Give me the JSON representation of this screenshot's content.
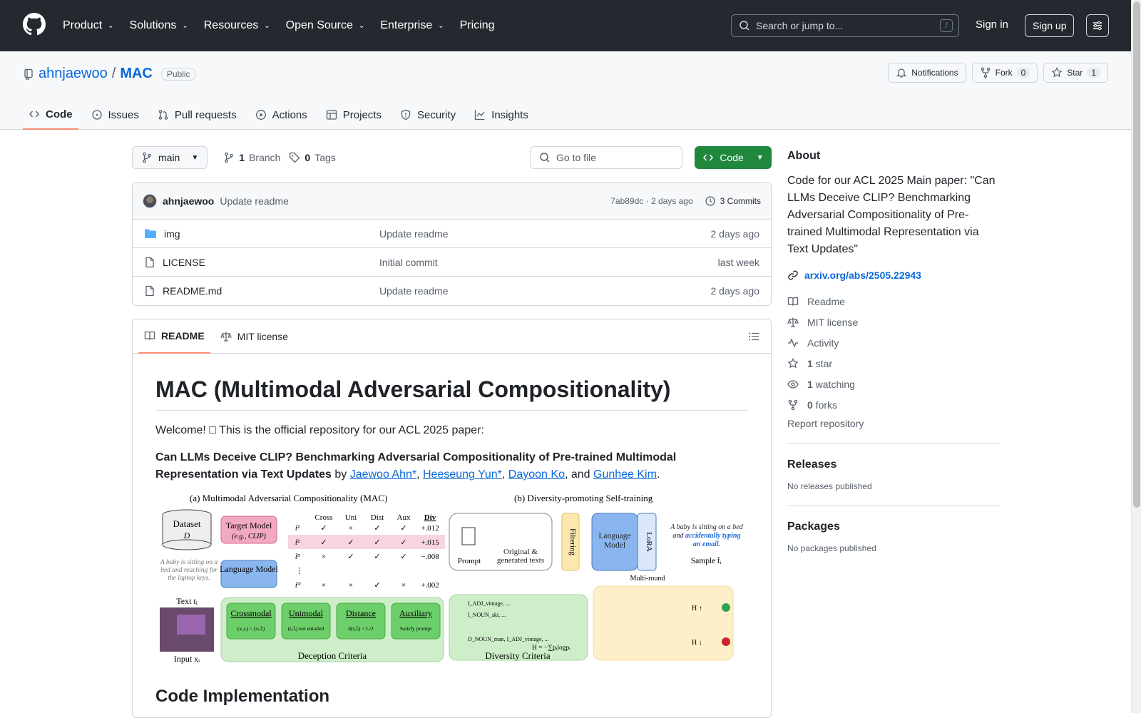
{
  "header": {
    "nav": [
      "Product",
      "Solutions",
      "Resources",
      "Open Source",
      "Enterprise",
      "Pricing"
    ],
    "search_placeholder": "Search or jump to...",
    "search_shortcut": "/",
    "signin": "Sign in",
    "signup": "Sign up"
  },
  "repo": {
    "owner": "ahnjaewoo",
    "separator": "/",
    "name": "MAC",
    "visibility": "Public",
    "notifications": "Notifications",
    "fork_label": "Fork",
    "fork_count": "0",
    "star_label": "Star",
    "star_count": "1"
  },
  "tabs": [
    "Code",
    "Issues",
    "Pull requests",
    "Actions",
    "Projects",
    "Security",
    "Insights"
  ],
  "filebar": {
    "branch": "main",
    "branch_count": "1",
    "branch_label": "Branch",
    "tag_count": "0",
    "tag_label": "Tags",
    "goto_placeholder": "Go to file",
    "code_button": "Code"
  },
  "commit": {
    "author": "ahnjaewoo",
    "message": "Update readme",
    "hash_time": "7ab89dc · 2 days ago",
    "commits": "3 Commits"
  },
  "files": [
    {
      "name": "img",
      "message": "Update readme",
      "date": "2 days ago"
    },
    {
      "name": "LICENSE",
      "message": "Initial commit",
      "date": "last week"
    },
    {
      "name": "README.md",
      "message": "Update readme",
      "date": "2 days ago"
    }
  ],
  "readme": {
    "tab_readme": "README",
    "tab_license": "MIT license",
    "title": "MAC (Multimodal Adversarial Compositionality)",
    "welcome": "Welcome! □ This is the official repository for our ACL 2025 paper:",
    "paper_title": "Can LLMs Deceive CLIP? Benchmarking Adversarial Compositionality of Pre-trained Multimodal Representation via Text Updates",
    "by": " by ",
    "authors": [
      "Jaewoo Ahn*",
      "Heeseung Yun*",
      "Dayoon Ko",
      "Gunhee Kim"
    ],
    "sep1": ", ",
    "sep_and": ", and ",
    "period": ".",
    "next_heading": "Code Implementation",
    "figure": {
      "title_a": "(a) Multimodal Adversarial Compositionality (MAC)",
      "title_b": "(b) Diversity-promoting Self-training",
      "dataset": "Dataset",
      "dataset_sym": "D",
      "target_model": "Target Model",
      "target_sub": "(e.g., CLIP)",
      "language_model": "Language Model",
      "caption": "A baby is sitting on a bed and reaching for the laptop keys.",
      "text_label": "Text tᵢ",
      "input_label": "Input xᵢ",
      "cols": [
        "Cross",
        "Uni",
        "Dist",
        "Aux",
        "Div"
      ],
      "rows": [
        {
          "label": "t̃¹",
          "marks": [
            "✓",
            "×",
            "✓",
            "✓"
          ],
          "div": "+.012"
        },
        {
          "label": "t̃²",
          "marks": [
            "✓",
            "✓",
            "✓",
            "✓"
          ],
          "div": "+.015"
        },
        {
          "label": "t̃³",
          "marks": [
            "×",
            "✓",
            "✓",
            "✓"
          ],
          "div": "−.008"
        },
        {
          "label": "t̃ᴺ",
          "marks": [
            "×",
            "×",
            "✓",
            "×"
          ],
          "div": "+.002"
        }
      ],
      "criteria": [
        {
          "name": "Crossmodal",
          "sub": "(xᵢ,tᵢ) < (xᵢ,t̃ᵢ)"
        },
        {
          "name": "Unimodal",
          "sub": "(tᵢ,t̃ᵢ) not entailed"
        },
        {
          "name": "Distance",
          "sub": "d(tᵢ,t̃ᵢ) < L/2"
        },
        {
          "name": "Auxiliary",
          "sub": "Satisfy prompt"
        }
      ],
      "deception": "Deception Criteria",
      "prompt": "Prompt",
      "orig_gen": "Original & generated texts",
      "filtering": "Filtering",
      "lora": "LoRA",
      "lm2": "Language Model",
      "sample_caption": "A baby is sitting on a bed and",
      "sample_caption_em": "accidentally typing an email.",
      "sample_label": "Sample t̃ᵢ",
      "multi_round": "Multi-round",
      "diversity": "Diversity Criteria",
      "entropy": "H = −∑pᵢlogpᵢ",
      "tokens": [
        "I_ADJ_vintage, ...",
        "I_NOUN_ski, ...",
        "D_NOUN_man, I_ADJ_vintage, ..."
      ],
      "h_up": "H ↑",
      "h_down": "H ↓"
    }
  },
  "about": {
    "heading": "About",
    "description": "Code for our ACL 2025 Main paper: \"Can LLMs Deceive CLIP? Benchmarking Adversarial Compositionality of Pre-trained Multimodal Representation via Text Updates\"",
    "link": "arxiv.org/abs/2505.22943",
    "items": [
      {
        "icon": "book-icon",
        "label": "Readme",
        "count": ""
      },
      {
        "icon": "law-icon",
        "label": "MIT license",
        "count": ""
      },
      {
        "icon": "pulse-icon",
        "label": "Activity",
        "count": ""
      },
      {
        "icon": "star-icon",
        "label": " star",
        "count": "1"
      },
      {
        "icon": "eye-icon",
        "label": " watching",
        "count": "1"
      },
      {
        "icon": "fork-icon",
        "label": " forks",
        "count": "0"
      }
    ],
    "report": "Report repository"
  },
  "releases": {
    "heading": "Releases",
    "text": "No releases published"
  },
  "packages": {
    "heading": "Packages",
    "text": "No packages published"
  },
  "colors": {
    "header_bg": "#24292f",
    "accent": "#0969da",
    "green": "#1f883d",
    "tab_underline": "#fd8c73"
  }
}
